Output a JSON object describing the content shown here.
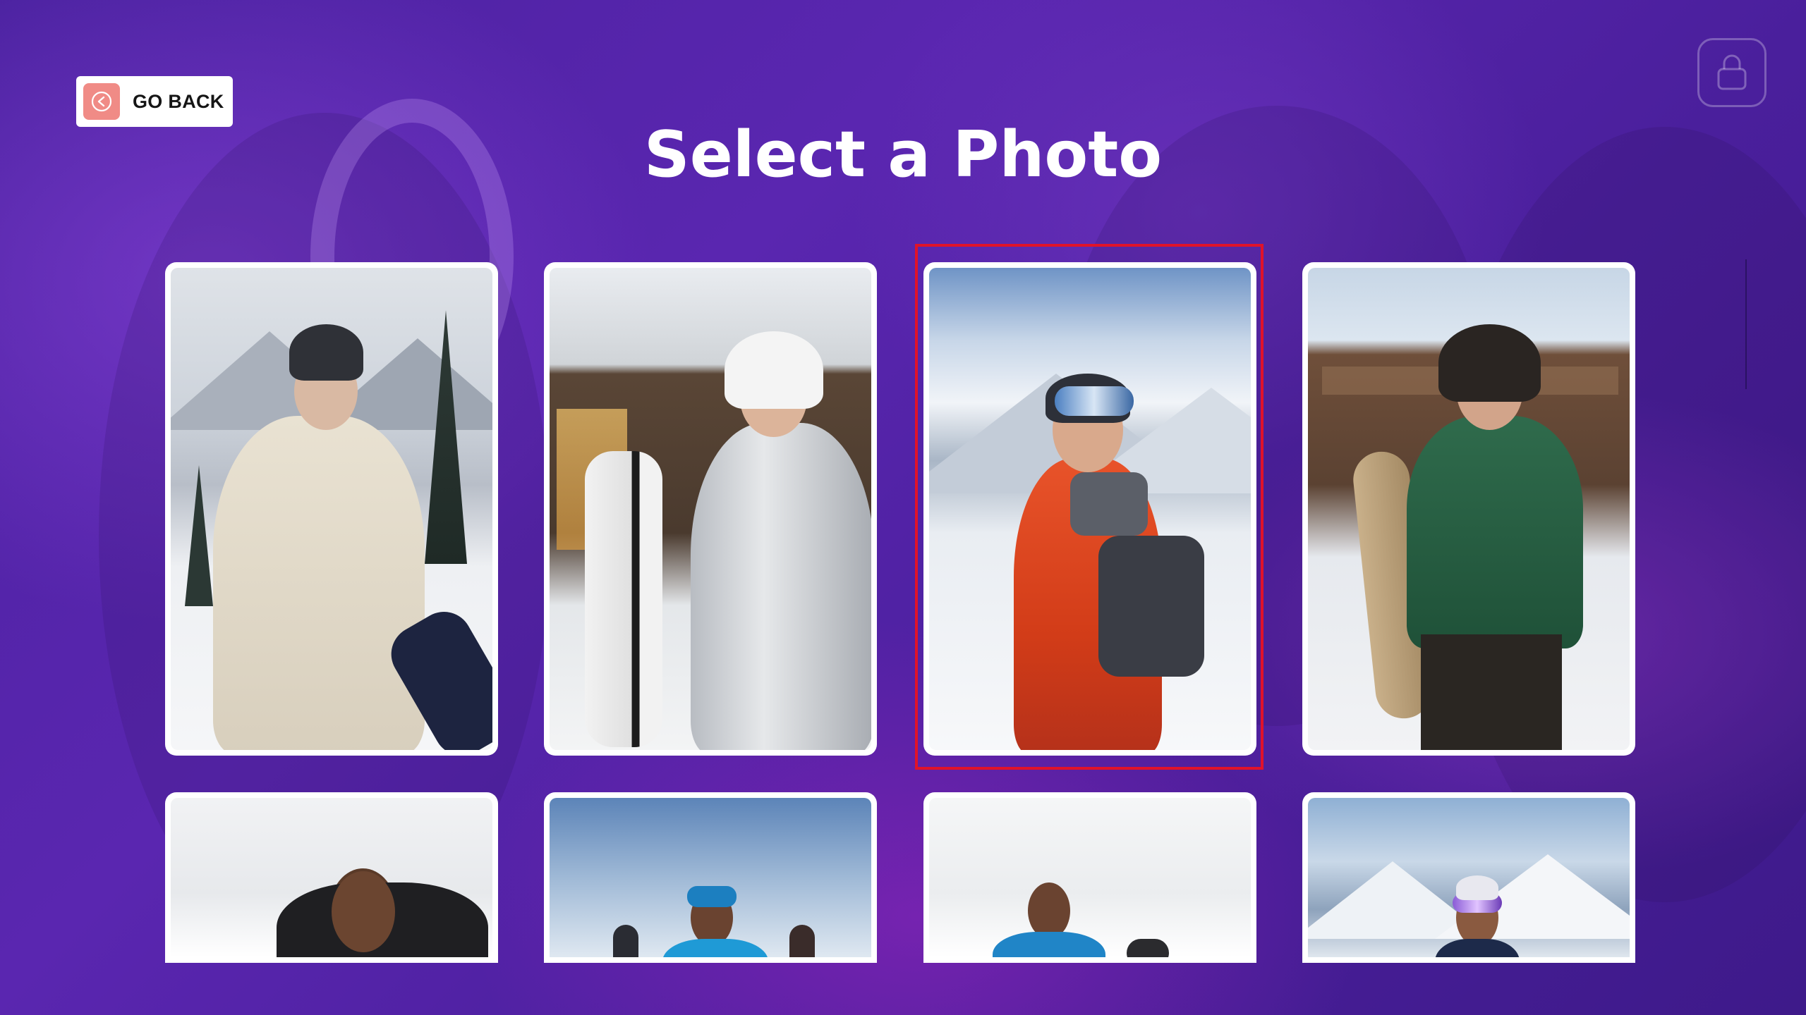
{
  "header": {
    "back_label": "GO BACK",
    "title": "Select a Photo"
  },
  "icons": {
    "back": "arrow-left-circle-icon",
    "lock": "lock-icon"
  },
  "colors": {
    "background": "#4a1f9c",
    "back_icon_bg": "#f08b86",
    "selection_outline": "#e0132a",
    "card": "#ffffff"
  },
  "photos": [
    {
      "description_id": "woman-cream-puffer-snowboard",
      "selected": false
    },
    {
      "description_id": "woman-silver-jacket-snowboard-chalet",
      "selected": false
    },
    {
      "description_id": "man-orange-jacket-snowboarding",
      "selected": true
    },
    {
      "description_id": "man-green-jacket-fur-hat-resort",
      "selected": false
    },
    {
      "description_id": "man-black-hoodie-snow",
      "selected": false
    },
    {
      "description_id": "man-blue-jacket-skis-goggles",
      "selected": false
    },
    {
      "description_id": "man-blue-jacket-snow-haze",
      "selected": false
    },
    {
      "description_id": "woman-goggles-mountains",
      "selected": false
    }
  ],
  "selected_index": 2
}
